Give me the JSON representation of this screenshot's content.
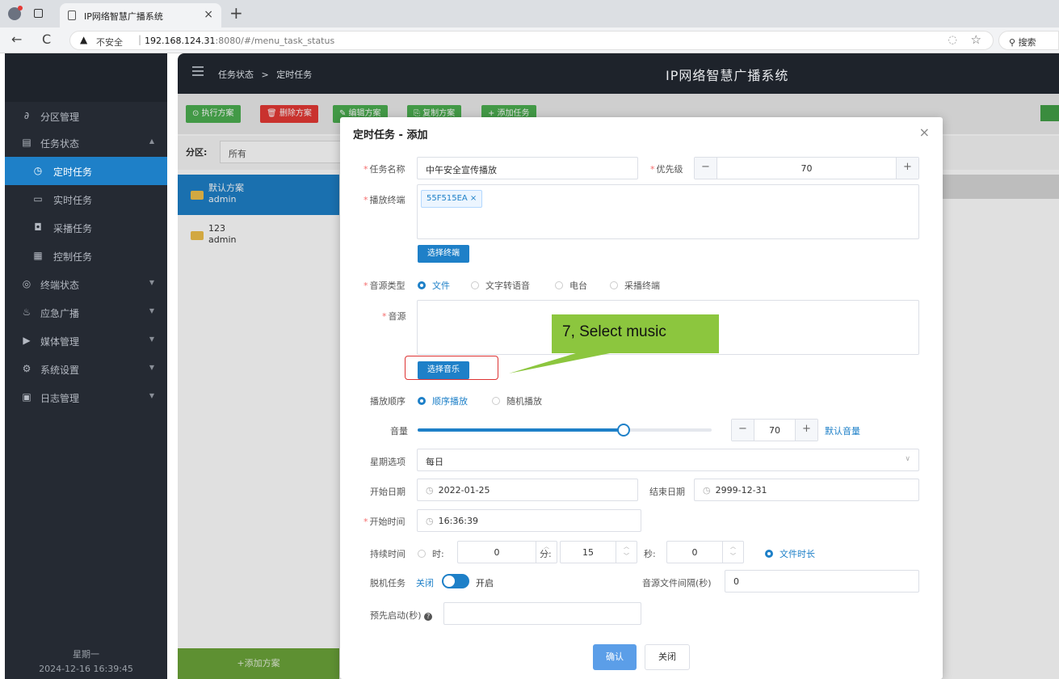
{
  "browser": {
    "tab_title": "IP网络智慧广播系统",
    "tab_close": "×",
    "new_tab": "+",
    "insecure_label": "不安全",
    "url_host": "192.168.124.31",
    "url_rest": ":8080/#/menu_task_status",
    "search_label": "搜索"
  },
  "sidebar": {
    "items": [
      {
        "label": "分区管理",
        "icon": "link-icon"
      },
      {
        "label": "任务状态",
        "icon": "list-icon"
      },
      {
        "label": "定时任务",
        "icon": "clock-doc-icon"
      },
      {
        "label": "实时任务",
        "icon": "monitor-icon"
      },
      {
        "label": "采播任务",
        "icon": "chip-icon"
      },
      {
        "label": "控制任务",
        "icon": "calc-icon"
      },
      {
        "label": "终端状态",
        "icon": "terminal-icon"
      },
      {
        "label": "应急广播",
        "icon": "broadcast-icon"
      },
      {
        "label": "媒体管理",
        "icon": "media-icon"
      },
      {
        "label": "系统设置",
        "icon": "gear-icon"
      },
      {
        "label": "日志管理",
        "icon": "log-icon"
      }
    ],
    "footer_day": "星期一",
    "footer_time": "2024-12-16 16:39:45"
  },
  "header": {
    "breadcrumb_parent": "任务状态",
    "breadcrumb_sep": ">",
    "breadcrumb_current": "定时任务",
    "app_title": "IP网络智慧广播系统"
  },
  "toolbar": {
    "run": "⊙ 执行方案",
    "delete": "🗑 删除方案",
    "edit": "✎ 编辑方案",
    "copy": "⎘ 复制方案",
    "add_task": "+ 添加任务"
  },
  "filter": {
    "label": "分区:",
    "value": "所有"
  },
  "plans": [
    {
      "name": "默认方案",
      "owner": "admin"
    },
    {
      "name": "123",
      "owner": "admin"
    }
  ],
  "add_plan": "+添加方案",
  "dialog": {
    "title": "定时任务 - 添加",
    "close": "×",
    "task_name_label": "任务名称",
    "task_name_value": "中午安全宣传播放",
    "priority_label": "优先级",
    "priority_value": "70",
    "terminal_label": "播放终端",
    "terminal_tag": "55F515EA",
    "select_terminal": "选择终端",
    "source_type_label": "音源类型",
    "source_types": [
      "文件",
      "文字转语音",
      "电台",
      "采播终端"
    ],
    "source_label": "音源",
    "select_music": "选择音乐",
    "play_order_label": "播放顺序",
    "play_orders": [
      "顺序播放",
      "随机播放"
    ],
    "volume_label": "音量",
    "volume_value": "70",
    "volume_fraction": 0.7,
    "default_volume": "默认音量",
    "weekday_label": "星期选项",
    "weekday_value": "每日",
    "start_date_label": "开始日期",
    "start_date_value": "2022-01-25",
    "end_date_label": "结束日期",
    "end_date_value": "2999-12-31",
    "start_time_label": "开始时间",
    "start_time_value": "16:36:39",
    "duration_label": "持续时间",
    "hour_label": "时:",
    "hour_value": "0",
    "minute_label": "分:",
    "minute_value": "15",
    "second_label": "秒:",
    "second_value": "0",
    "file_duration": "文件时长",
    "offline_label": "脱机任务",
    "offline_off": "关闭",
    "offline_on": "开启",
    "interval_label": "音源文件间隔(秒)",
    "interval_value": "0",
    "prestart_label": "预先启动(秒)",
    "confirm": "确认",
    "cancel": "关闭"
  },
  "annotation": {
    "text": "7, Select music"
  },
  "colors": {
    "accent": "#1e80c8",
    "callout": "#8cc63e",
    "required": "#f56c6c"
  }
}
